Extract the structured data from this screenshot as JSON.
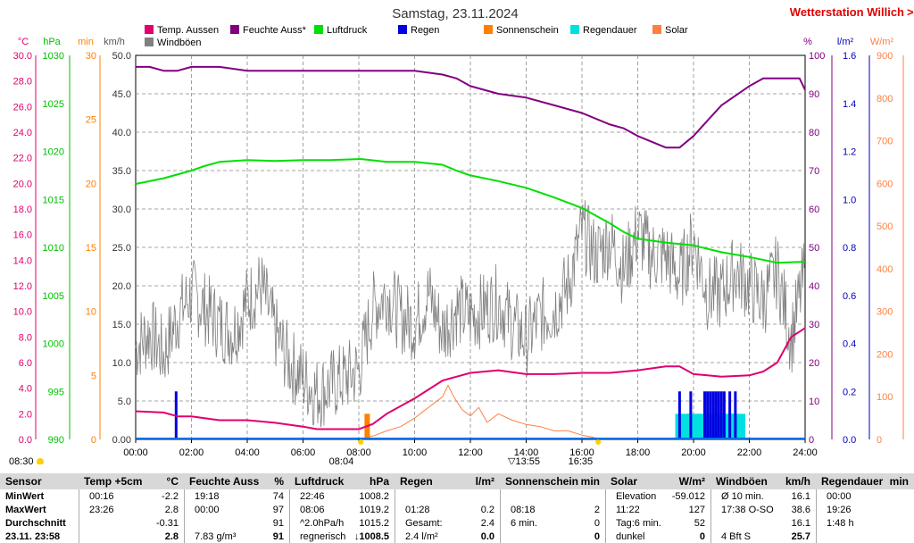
{
  "header": {
    "title": "Samstag, 23.11.2024",
    "station": "Wetterstation Willich",
    "station_overflow_glyph": ">"
  },
  "legend": [
    {
      "label": "Temp. Aussen",
      "color": "#e0006e"
    },
    {
      "label": "Feuchte Auss*",
      "color": "#800080"
    },
    {
      "label": "Luftdruck",
      "color": "#00e000"
    },
    {
      "label": "Regen",
      "color": "#0000e0"
    },
    {
      "label": "Sonnenschein",
      "color": "#ff8000"
    },
    {
      "label": "Regendauer",
      "color": "#00e0e0"
    },
    {
      "label": "Solar",
      "color": "#ff8040"
    },
    {
      "label": "Windböen",
      "color": "#808080"
    }
  ],
  "axes": {
    "units": {
      "temp": "°C",
      "pressure": "hPa",
      "sun": "min",
      "wind": "km/h",
      "hum": "%",
      "rain": "l/m²",
      "solar": "W/m²"
    },
    "temp_ticks": [
      "30.0",
      "28.0",
      "26.0",
      "24.0",
      "22.0",
      "20.0",
      "18.0",
      "16.0",
      "14.0",
      "12.0",
      "10.0",
      "8.0",
      "6.0",
      "4.0",
      "2.0",
      "0.0"
    ],
    "pressure_ticks": [
      "1030",
      "1025",
      "1020",
      "1015",
      "1010",
      "1005",
      "1000",
      "995",
      "990"
    ],
    "sun_ticks": [
      "30",
      "25",
      "20",
      "15",
      "10",
      "5",
      "0"
    ],
    "wind_ticks": [
      "50.0",
      "45.0",
      "40.0",
      "35.0",
      "30.0",
      "25.0",
      "20.0",
      "15.0",
      "10.0",
      "5.0",
      "0.00"
    ],
    "hum_ticks": [
      "100",
      "90",
      "80",
      "70",
      "60",
      "50",
      "40",
      "30",
      "20",
      "10",
      "0"
    ],
    "rain_ticks": [
      "1.6",
      "1.4",
      "1.2",
      "1.0",
      "0.8",
      "0.6",
      "0.4",
      "0.2",
      "0.0"
    ],
    "solar_ticks": [
      "900",
      "800",
      "700",
      "600",
      "500",
      "400",
      "300",
      "200",
      "100",
      "0"
    ],
    "x_ticks": [
      "00:00",
      "02:00",
      "04:00",
      "06:00",
      "08:00",
      "10:00",
      "12:00",
      "14:00",
      "16:00",
      "18:00",
      "20:00",
      "22:00",
      "24:00"
    ],
    "markers": {
      "sunrise_left": "08:30",
      "sunrise": "08:04",
      "noon": "13:55",
      "sunset": "16:35"
    }
  },
  "colors": {
    "grid": "#888888",
    "temp": "#e0006e",
    "hum": "#800080",
    "pressure": "#00e000",
    "rain": "#0000e0",
    "sun": "#ff8000",
    "raindur": "#00e0e0",
    "solar": "#ff8040",
    "wind": "#808080",
    "station": "#e00000"
  },
  "chart_data": {
    "type": "line",
    "title": "Samstag, 23.11.2024",
    "x_unit": "hours",
    "xlim": [
      0,
      24
    ],
    "series": [
      {
        "name": "Temp. Aussen",
        "unit": "°C",
        "ylim": [
          0,
          30
        ],
        "x": [
          0,
          1,
          1.5,
          2,
          3,
          4,
          5,
          6,
          6.5,
          7,
          8,
          8.5,
          9,
          10,
          11,
          12,
          13,
          14,
          15,
          16,
          17,
          18,
          19,
          19.5,
          20,
          20.5,
          21,
          22,
          22.5,
          23,
          23.5,
          24
        ],
        "y": [
          2.2,
          2.1,
          1.8,
          1.8,
          1.5,
          1.5,
          1.3,
          1.0,
          0.8,
          0.8,
          0.8,
          1.2,
          2.0,
          3.2,
          4.6,
          5.2,
          5.4,
          5.1,
          5.1,
          5.2,
          5.2,
          5.4,
          5.7,
          5.7,
          5.1,
          5.0,
          4.9,
          5.0,
          5.3,
          6.0,
          8.0,
          8.7
        ]
      },
      {
        "name": "Feuchte Auss*",
        "unit": "%",
        "ylim": [
          0,
          100
        ],
        "x": [
          0,
          0.5,
          1,
          1.5,
          2,
          3,
          4,
          5,
          6,
          7,
          8,
          9,
          10,
          11,
          11.5,
          12,
          13,
          14,
          15,
          16,
          17,
          17.5,
          18,
          19,
          19.5,
          20,
          20.5,
          21,
          22,
          22.5,
          23,
          23.5,
          23.8,
          24
        ],
        "y": [
          97,
          97,
          96,
          96,
          97,
          97,
          96,
          96,
          96,
          96,
          96,
          96,
          96,
          95,
          94,
          92,
          90,
          89,
          87,
          85,
          82,
          81,
          79,
          76,
          76,
          79,
          83,
          87,
          92,
          94,
          94,
          94,
          94,
          91
        ]
      },
      {
        "name": "Luftdruck",
        "unit": "hPa",
        "ylim": [
          990,
          1030
        ],
        "x": [
          0,
          1,
          2,
          2.5,
          3,
          4,
          5,
          6,
          7,
          8,
          8.1,
          9,
          10,
          11,
          11.5,
          12,
          13,
          14,
          15,
          16,
          17,
          17.5,
          18,
          19,
          20,
          21,
          22,
          23,
          24
        ],
        "y": [
          1016.6,
          1017.2,
          1018.0,
          1018.5,
          1018.9,
          1019.1,
          1019.0,
          1019.1,
          1019.1,
          1019.2,
          1019.2,
          1018.9,
          1018.9,
          1018.6,
          1018.0,
          1017.5,
          1016.9,
          1016.2,
          1015.2,
          1014.1,
          1012.5,
          1011.6,
          1010.9,
          1010.5,
          1010.2,
          1009.5,
          1009.0,
          1008.4,
          1008.5
        ]
      },
      {
        "name": "Solar",
        "unit": "W/m²",
        "ylim": [
          0,
          900
        ],
        "x": [
          8.1,
          8.6,
          9,
          9.5,
          10,
          10.5,
          11,
          11.2,
          11.4,
          11.7,
          12,
          12.3,
          12.6,
          13,
          13.5,
          14,
          14.5,
          15,
          15.5,
          16,
          16.4,
          16.6
        ],
        "y": [
          0,
          10,
          20,
          30,
          50,
          75,
          100,
          127,
          100,
          70,
          55,
          75,
          40,
          60,
          45,
          35,
          30,
          20,
          20,
          10,
          5,
          0
        ]
      },
      {
        "name": "Windböen",
        "unit": "km/h",
        "ylim": [
          0,
          50
        ],
        "x": [
          0,
          0.5,
          1,
          1.5,
          2,
          2.5,
          3,
          3.5,
          4,
          4.5,
          5,
          5.5,
          6,
          6.5,
          7,
          7.5,
          8,
          8.5,
          9,
          9.5,
          10,
          10.5,
          11,
          11.5,
          12,
          12.5,
          13,
          13.5,
          14,
          14.5,
          15,
          15.5,
          16,
          16.5,
          17,
          17.5,
          18,
          18.5,
          19,
          19.5,
          20,
          20.5,
          21,
          21.5,
          22,
          22.5,
          23,
          23.5,
          24
        ],
        "y": [
          12,
          14,
          11,
          16,
          19,
          17,
          15,
          14,
          18,
          20,
          14,
          10,
          8,
          6,
          7,
          8,
          9,
          17,
          19,
          16,
          15,
          19,
          14,
          17,
          16,
          17,
          18,
          15,
          13,
          16,
          17,
          20,
          27,
          24,
          26,
          22,
          27,
          24,
          24,
          21,
          26,
          19,
          19,
          22,
          20,
          18,
          22,
          13,
          22
        ]
      },
      {
        "name": "Regen",
        "unit": "l/m²",
        "type": "bar",
        "ylim": [
          0,
          1.6
        ],
        "x": [
          1.45,
          19.5,
          19.9,
          20.4,
          20.5,
          20.6,
          20.7,
          20.8,
          20.9,
          21.0,
          21.1,
          21.3,
          21.5
        ],
        "y": [
          0.2,
          0.2,
          0.2,
          0.2,
          0.2,
          0.2,
          0.2,
          0.2,
          0.2,
          0.2,
          0.2,
          0.2,
          0.2
        ]
      },
      {
        "name": "Sonnenschein",
        "unit": "min",
        "type": "bar",
        "ylim": [
          0,
          30
        ],
        "x": [
          8.3
        ],
        "y": [
          2
        ]
      },
      {
        "name": "Regendauer",
        "unit": "min",
        "type": "bar",
        "ylim": [
          0,
          30
        ],
        "x": [
          19.6,
          20.0,
          20.4,
          20.8,
          21.2,
          21.6
        ],
        "y": [
          2,
          2,
          2,
          2,
          2,
          2
        ]
      }
    ]
  },
  "table": {
    "row_labels": [
      "Sensor",
      "MinWert",
      "MaxWert",
      "Durchschnitt",
      "23.11. 23:58"
    ],
    "columns": [
      {
        "header": "Temp +5cm",
        "unit": "°C",
        "rows": [
          [
            "00:16",
            "-2.2"
          ],
          [
            "23:26",
            "2.8"
          ],
          [
            "",
            "-0.31"
          ],
          [
            "",
            "2.8"
          ]
        ]
      },
      {
        "header": "Feuchte Auss",
        "unit": "%",
        "rows": [
          [
            "19:18",
            "74"
          ],
          [
            "00:00",
            "97"
          ],
          [
            "",
            "91"
          ],
          [
            "7.83 g/m³",
            "91"
          ]
        ]
      },
      {
        "header": "Luftdruck",
        "unit": "hPa",
        "rows": [
          [
            "22:46",
            "1008.2"
          ],
          [
            "08:06",
            "1019.2"
          ],
          [
            "^2.0hPa/h",
            "1015.2"
          ],
          [
            "regnerisch",
            "↓1008.5"
          ]
        ]
      },
      {
        "header": "Regen",
        "unit": "l/m²",
        "rows": [
          [
            "",
            ""
          ],
          [
            "01:28",
            "0.2"
          ],
          [
            "Gesamt:",
            "2.4"
          ],
          [
            "2.4 l/m²",
            "0.0"
          ]
        ]
      },
      {
        "header": "Sonnenschein",
        "unit": "min",
        "rows": [
          [
            "",
            ""
          ],
          [
            "08:18",
            "2"
          ],
          [
            "6 min.",
            "0"
          ],
          [
            "",
            "0"
          ]
        ]
      },
      {
        "header": "Solar",
        "unit": "W/m²",
        "rows": [
          [
            "Elevation",
            "-59.012"
          ],
          [
            "11:22",
            "127"
          ],
          [
            "Tag:6 min.",
            "52"
          ],
          [
            "dunkel",
            "0"
          ]
        ]
      },
      {
        "header": "Windböen",
        "unit": "km/h",
        "rows": [
          [
            "Ø 10 min.",
            "16.1"
          ],
          [
            "17:38 O-SO",
            "38.6"
          ],
          [
            "",
            "16.1"
          ],
          [
            "4 Bft S",
            "25.7"
          ]
        ]
      },
      {
        "header": "Regendauer",
        "unit": "min",
        "rows": [
          [
            "00:00",
            ""
          ],
          [
            "19:26",
            ""
          ],
          [
            "1:48 h",
            ""
          ],
          [
            "",
            ""
          ]
        ]
      }
    ]
  }
}
